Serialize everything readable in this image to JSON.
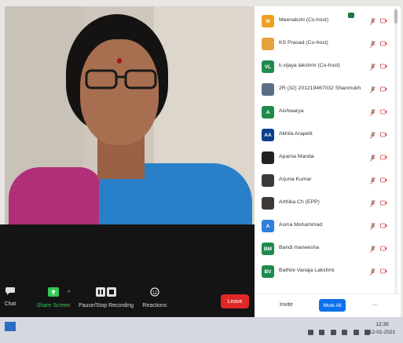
{
  "toolbar": {
    "chat_label": "Chat",
    "share_label": "Share Screen",
    "record_label": "Pause/Stop Recording",
    "reactions_label": "Reactions",
    "leave_label": "Leave"
  },
  "participants": [
    {
      "initials": "M",
      "color": "#f0a020",
      "name": "Meenakshi (Co-host)"
    },
    {
      "initials": "",
      "color": "#e5a23a",
      "name": "KS Prasad (Co-host)"
    },
    {
      "initials": "VL",
      "color": "#1f8a4c",
      "name": "k.vijaya lakshmi (Co-host)"
    },
    {
      "initials": "",
      "color": "#5a6f86",
      "name": "2R (32) 201219467032 Shanmukh"
    },
    {
      "initials": "A",
      "color": "#1f8a4c",
      "name": "Aishwarya"
    },
    {
      "initials": "AA",
      "color": "#0b3f8c",
      "name": "Akhila Arapelli"
    },
    {
      "initials": "",
      "color": "#222222",
      "name": "Aparna Manda"
    },
    {
      "initials": "",
      "color": "#3a3a3a",
      "name": "Arjuna Kumar"
    },
    {
      "initials": "",
      "color": "#403a36",
      "name": "Arthika Ch (EPP)"
    },
    {
      "initials": "A",
      "color": "#2f7fdf",
      "name": "Asma Mohammad"
    },
    {
      "initials": "BM",
      "color": "#1f8a4c",
      "name": "Bandi maneesha"
    },
    {
      "initials": "BV",
      "color": "#1f8a4c",
      "name": "Bathini Vanaja Lakshmi"
    }
  ],
  "panel": {
    "invite_label": "Invite",
    "mute_all_label": "Mute All",
    "more_label": "..."
  },
  "taskbar": {
    "time": "12:35",
    "date": "12-01-2021"
  }
}
